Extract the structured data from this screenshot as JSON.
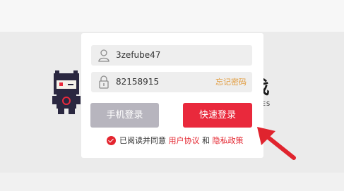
{
  "login": {
    "username_value": "3zefube47",
    "password_value": "82158915",
    "forgot_label": "忘记密码",
    "phone_login_label": "手机登录",
    "quick_login_label": "快速登录",
    "agree_prefix": "已阅读并同意",
    "user_agreement": "用户协议",
    "and_text": "和",
    "privacy_policy": "隐私政策"
  },
  "background": {
    "logo_text": "戏",
    "logo_sub": "ES"
  },
  "icons": [
    "user-icon",
    "lock-icon",
    "check-icon",
    "red-arrow-icon",
    "mascot-icon"
  ],
  "colors": {
    "accent": "#e9293c",
    "secondary_button": "#b7b5be",
    "link": "#e4252f",
    "forgot": "#e29a3a"
  }
}
